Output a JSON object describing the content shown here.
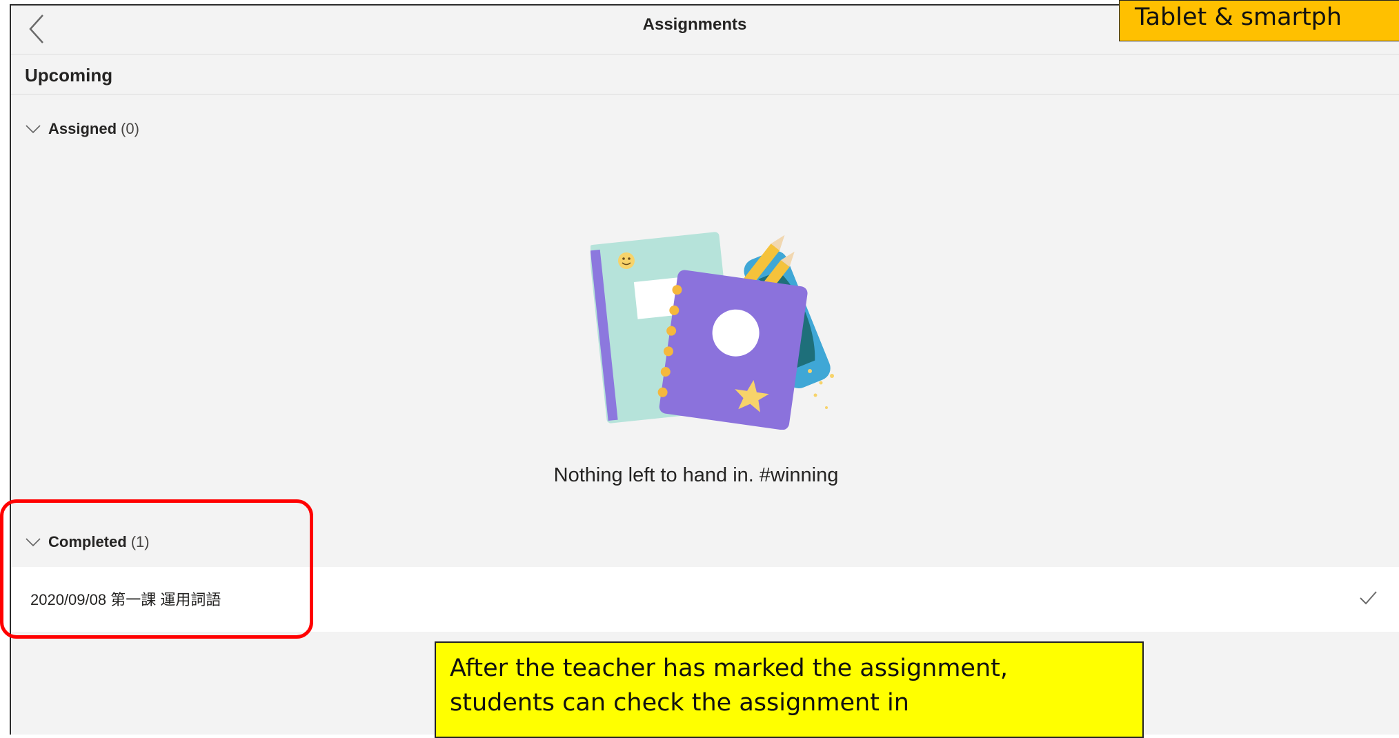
{
  "header": {
    "title": "Assignments"
  },
  "tag": "Tablet & smartph",
  "upcoming": {
    "label": "Upcoming"
  },
  "assigned": {
    "label": "Assigned",
    "count": "(0)"
  },
  "empty_state": {
    "text": "Nothing left to hand in. #winning"
  },
  "completed": {
    "label": "Completed",
    "count": "(1)",
    "items": [
      {
        "title": "2020/09/08 第一課 運用詞語"
      }
    ]
  },
  "callout": "After the teacher has marked the assignment,\nstudents can check the assignment in",
  "colors": {
    "highlight": "#ff0000",
    "callout_bg": "#ffff00",
    "tag_bg": "#ffc000",
    "page_bg": "#f3f3f3"
  }
}
